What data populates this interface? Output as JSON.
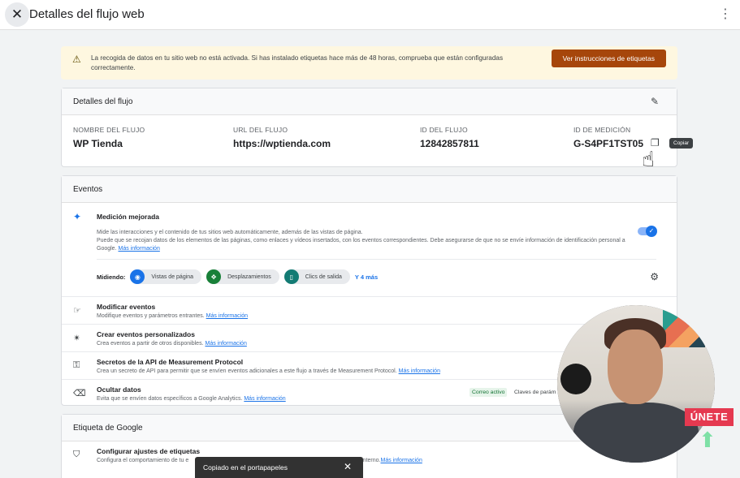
{
  "header": {
    "title": "Detalles del flujo web",
    "close_icon": "close-icon",
    "menu_icon": "more-vert-icon"
  },
  "banner": {
    "text": "La recogida de datos en tu sitio web no está activada. Si has instalado etiquetas hace más de 48 horas, comprueba que están configuradas correctamente.",
    "button_label": "Ver instrucciones de etiquetas"
  },
  "stream_details": {
    "heading": "Detalles del flujo",
    "fields": [
      {
        "label": "NOMBRE DEL FLUJO",
        "value": "WP Tienda"
      },
      {
        "label": "URL DEL FLUJO",
        "value": "https://wptienda.com"
      },
      {
        "label": "ID DEL FLUJO",
        "value": "12842857811"
      },
      {
        "label": "ID DE MEDICIÓN",
        "value": "G-S4PF1TST05"
      }
    ],
    "copy_tooltip": "Copiar"
  },
  "events": {
    "heading": "Eventos",
    "enhanced": {
      "title": "Medición mejorada",
      "desc1": "Mide las interacciones y el contenido de tus sitios web automáticamente, además de las vistas de página.",
      "desc2": "Puede que se recojan datos de los elementos de las páginas, como enlaces y vídeos insertados, con los eventos correspondientes. Debe asegurarse de que no se envíe información de identificación personal a Google.",
      "link": "Más información",
      "measuring_label": "Midiendo:",
      "chips": [
        "Vistas de página",
        "Desplazamientos",
        "Clics de salida"
      ],
      "more": "Y 4 más",
      "toggle_on": true
    },
    "rows": [
      {
        "title": "Modificar eventos",
        "desc": "Modifique eventos y parámetros entrantes.",
        "link": "Más información"
      },
      {
        "title": "Crear eventos personalizados",
        "desc": "Crea eventos a partir de otros disponibles.",
        "link": "Más información"
      },
      {
        "title": "Secretos de la API de Measurement Protocol",
        "desc": "Crea un secreto de API para permitir que se envíen eventos adicionales a este flujo a través de Measurement Protocol.",
        "link": "Más información"
      },
      {
        "title": "Ocultar datos",
        "desc": "Evita que se envíen datos específicos a Google Analytics.",
        "link": "Más información",
        "badge": "Correo activo",
        "badge2": "Claves de parám"
      }
    ]
  },
  "google_tag": {
    "heading": "Etiqueta de Google",
    "row": {
      "title": "Configurar ajustes de etiquetas",
      "desc": "Configura el comportamiento de tu e",
      "desc_tail": "ico interno.",
      "link": "Más información"
    }
  },
  "snackbar": {
    "text": "Copiado en el portapapeles"
  },
  "overlay": {
    "cta": "ÚNETE"
  }
}
